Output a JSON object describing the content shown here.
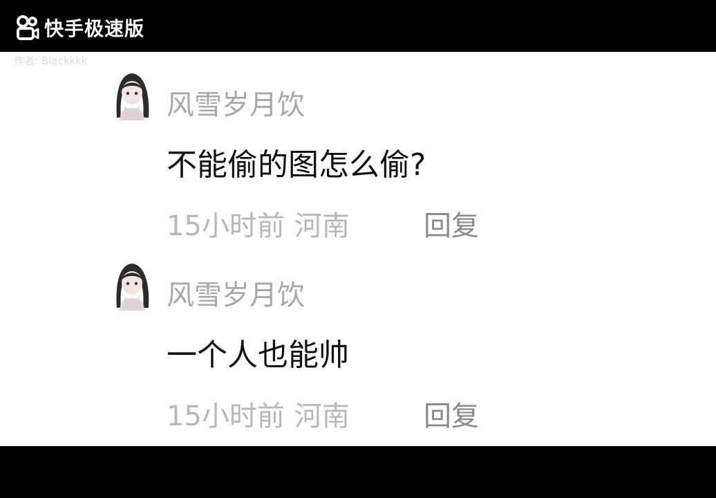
{
  "app": {
    "name": "快手极速版",
    "author_watermark": "作者: Blackkkk"
  },
  "comments": [
    {
      "username": "风雪岁月饮",
      "text": "不能偷的图怎么偷?",
      "time": "15小时前",
      "location": "河南",
      "reply_label": "回复"
    },
    {
      "username": "风雪岁月饮",
      "text": "一个人也能帅",
      "time": "15小时前",
      "location": "河南",
      "reply_label": "回复"
    }
  ],
  "colors": {
    "letterbox": "#000000",
    "background": "#ffffff",
    "username": "#a8a8a8",
    "text": "#111111",
    "meta": "#b8b8b8",
    "reply": "#8a8a8a"
  },
  "icons": [
    "kuaishou-logo-icon",
    "avatar-image"
  ]
}
